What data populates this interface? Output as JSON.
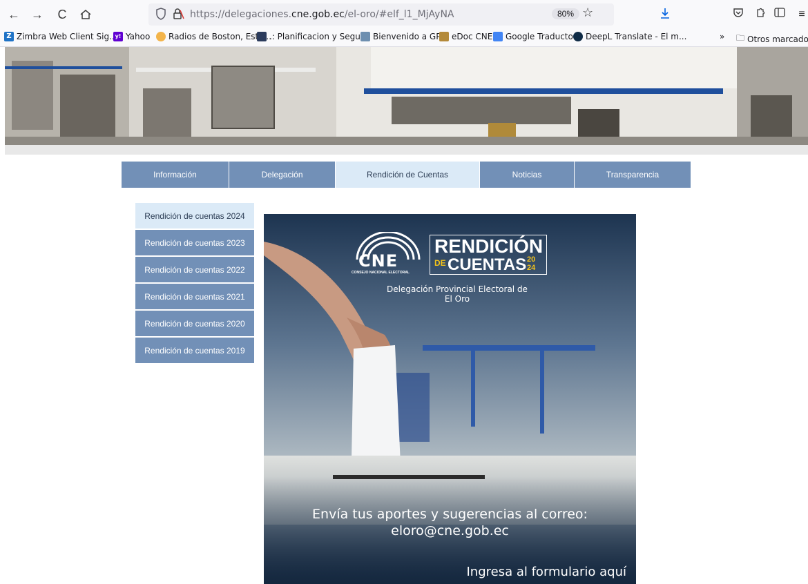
{
  "browser": {
    "url_prefix": "https://delegaciones.",
    "url_domain": "cne.gob.ec",
    "url_path": "/el-oro/#elf_l1_MjAyNA",
    "zoom": "80%",
    "bookmarks": [
      {
        "label": "Zimbra Web Client Sig...",
        "icon_text": "Z",
        "icon_color": "#1f73c6"
      },
      {
        "label": "Yahoo",
        "icon_text": "y!",
        "icon_color": "#6001d2"
      },
      {
        "label": "Radios de Boston, Esta...",
        "icon_text": "",
        "icon_color": "#f3b44a"
      },
      {
        "label": ".: Planificacion y Segui...",
        "icon_text": "",
        "icon_color": "#2b3b5c"
      },
      {
        "label": "Bienvenido a GPR",
        "icon_text": "",
        "icon_color": "#6e8fb0"
      },
      {
        "label": "eDoc CNE",
        "icon_text": "",
        "icon_color": "#b48a3a"
      },
      {
        "label": "Google Traductor",
        "icon_text": "",
        "icon_color": "#4285f4"
      },
      {
        "label": "DeepL Translate - El m...",
        "icon_text": "",
        "icon_color": "#0f2b46"
      }
    ],
    "other_bookmarks": "Otros marcadores"
  },
  "nav": {
    "items": [
      "Información",
      "Delegación",
      "Rendición de Cuentas",
      "Noticias",
      "Transparencia"
    ],
    "active_index": 2
  },
  "sidebar": {
    "items": [
      "Rendición de cuentas 2024",
      "Rendición de cuentas 2023",
      "Rendición de cuentas 2022",
      "Rendición de cuentas 2021",
      "Rendición de cuentas 2020",
      "Rendición de cuentas 2019"
    ],
    "active_index": 0
  },
  "poster": {
    "logo_text": "CNE",
    "logo_sub": "CONSEJO NACIONAL ELECTORAL",
    "title_line1": "RENDICIÓN",
    "title_de": "DE",
    "title_line2": "CUENTAS",
    "year_top": "20",
    "year_bottom": "24",
    "subtitle_line1": "Delegación Provincial Electoral de",
    "subtitle_line2": "El Oro",
    "message_line1": "Envía tus aportes y sugerencias al correo:",
    "message_line2": "eloro@cne.gob.ec",
    "cta": "Ingresa al formulario aquí"
  },
  "colors": {
    "nav_bg": "#7290b7",
    "nav_active_bg": "#dbeaf7",
    "accent_yellow": "#f2c21b",
    "accent_red": "#d9312d"
  }
}
